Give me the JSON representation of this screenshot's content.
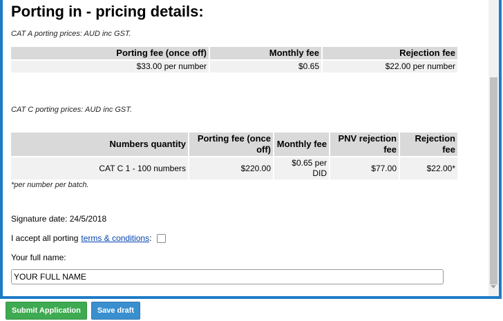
{
  "title": "Porting in - pricing details:",
  "cat_a": {
    "note": "CAT A porting prices: AUD inc GST.",
    "headers": [
      "Porting fee (once off)",
      "Monthly fee",
      "Rejection fee"
    ],
    "row": [
      "$33.00 per number",
      "$0.65",
      "$22.00 per number"
    ]
  },
  "cat_c": {
    "note": "CAT C porting prices: AUD inc GST.",
    "headers": [
      "Numbers quantity",
      "Porting fee (once off)",
      "Monthly fee",
      "PNV rejection fee",
      "Rejection fee"
    ],
    "row": [
      "CAT C 1 - 100 numbers",
      "$220.00",
      "$0.65 per DID",
      "$77.00",
      "$22.00*"
    ],
    "footnote": "*per number per batch."
  },
  "signature": "Signature date: 24/5/2018",
  "accept": {
    "text": "I accept all porting",
    "link": "terms & conditions",
    "suffix": ":"
  },
  "fullname": {
    "label": "Your full name:",
    "value": "YOUR FULL NAME"
  },
  "buttons": {
    "submit": "Submit Application",
    "draft": "Save draft"
  },
  "colors": {
    "frame": "#1d7bc6",
    "submit": "#3eaa51",
    "draft": "#3a8fcf",
    "link": "#0645ad"
  }
}
